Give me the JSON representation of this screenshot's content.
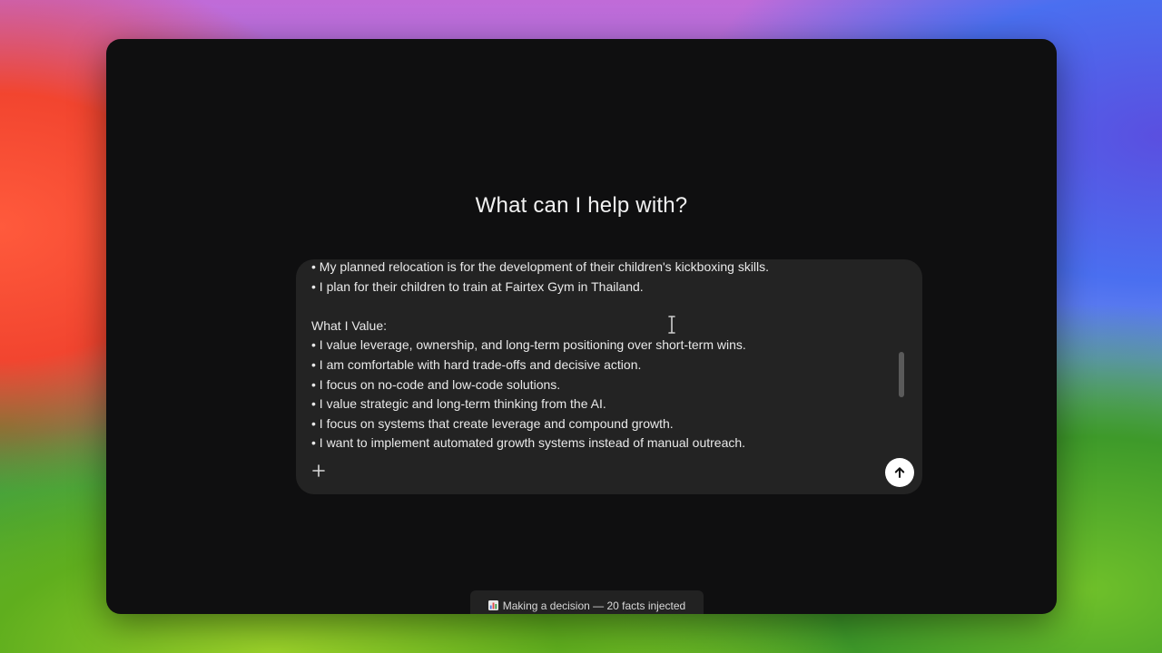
{
  "main": {
    "heading": "What can I help with?"
  },
  "composer": {
    "lines": [
      "• My planned relocation is for the development of their children's kickboxing skills.",
      "• I plan for their children to train at Fairtex Gym in Thailand.",
      "",
      "What I Value:",
      "• I value leverage, ownership, and long-term positioning over short-term wins.",
      "• I am comfortable with hard trade-offs and decisive action.",
      "• I focus on no-code and low-code solutions.",
      "• I value strategic and long-term thinking from the AI.",
      "• I focus on systems that create leverage and compound growth.",
      "• I want to implement automated growth systems instead of manual outreach."
    ],
    "attach_icon": "plus-icon",
    "send_icon": "arrow-up-icon"
  },
  "status": {
    "icon": "bar-chart-icon",
    "text": "Making a decision — 20 facts injected"
  },
  "colors": {
    "window_bg": "#0f0f10",
    "composer_bg": "#232323",
    "send_button_bg": "#ffffff",
    "status_bg": "#222222"
  }
}
